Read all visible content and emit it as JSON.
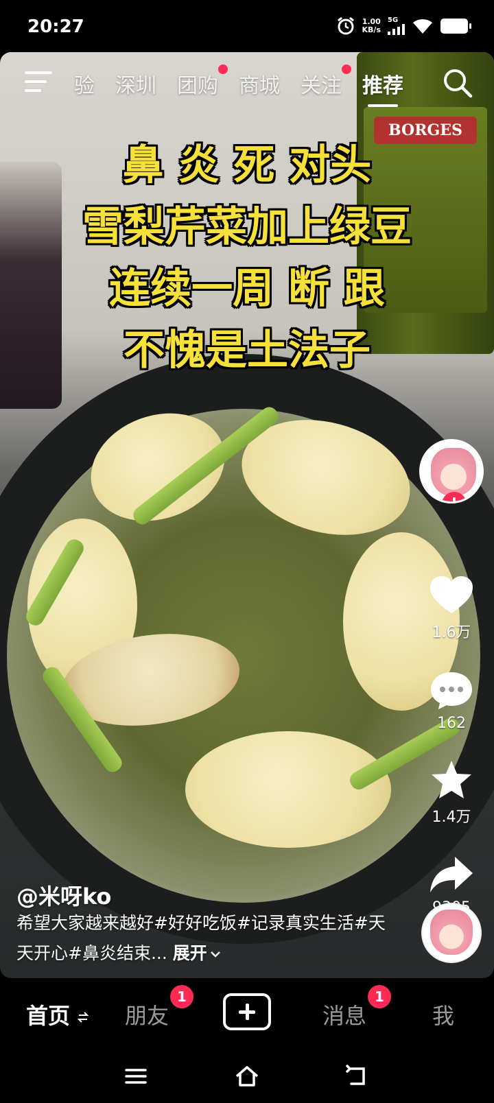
{
  "status_bar": {
    "time": "20:27",
    "net_speed_value": "1.00",
    "net_speed_unit": "KB/s",
    "signal_label": "5G"
  },
  "top_nav": {
    "tabs": [
      {
        "label": "验",
        "active": false,
        "dot": false
      },
      {
        "label": "深圳",
        "active": false,
        "dot": false
      },
      {
        "label": "团购",
        "active": false,
        "dot": true
      },
      {
        "label": "商城",
        "active": false,
        "dot": false
      },
      {
        "label": "关注",
        "active": false,
        "dot": true
      },
      {
        "label": "推荐",
        "active": true,
        "dot": false
      }
    ]
  },
  "video": {
    "caption_lines": [
      "鼻 炎 死 对头",
      "雪梨芹菜加上绿豆",
      "连续一周 断 跟",
      "不愧是土法子"
    ],
    "bottle_text": "BORGES"
  },
  "rail": {
    "likes": "1.6万",
    "comments": "162",
    "favorites": "1.4万",
    "shares": "9305"
  },
  "post": {
    "author": "@米呀ko",
    "description": "希望大家越来越好#好好吃饭#记录真实生活#天天开心#鼻炎结束...",
    "expand_label": "展开"
  },
  "tab_bar": {
    "home": "首页",
    "friends": "朋友",
    "friends_badge": "1",
    "messages": "消息",
    "messages_badge": "1",
    "me": "我"
  },
  "colors": {
    "accent": "#fe2c55",
    "caption": "#f6e03a"
  },
  "icons": [
    "alarm-icon",
    "signal-icon",
    "wifi-icon",
    "battery-icon",
    "menu-icon",
    "search-icon",
    "heart-icon",
    "comment-icon",
    "star-icon",
    "share-icon",
    "plus-icon",
    "swap-icon",
    "chevron-down-icon",
    "recents-icon",
    "home-icon",
    "back-icon"
  ]
}
